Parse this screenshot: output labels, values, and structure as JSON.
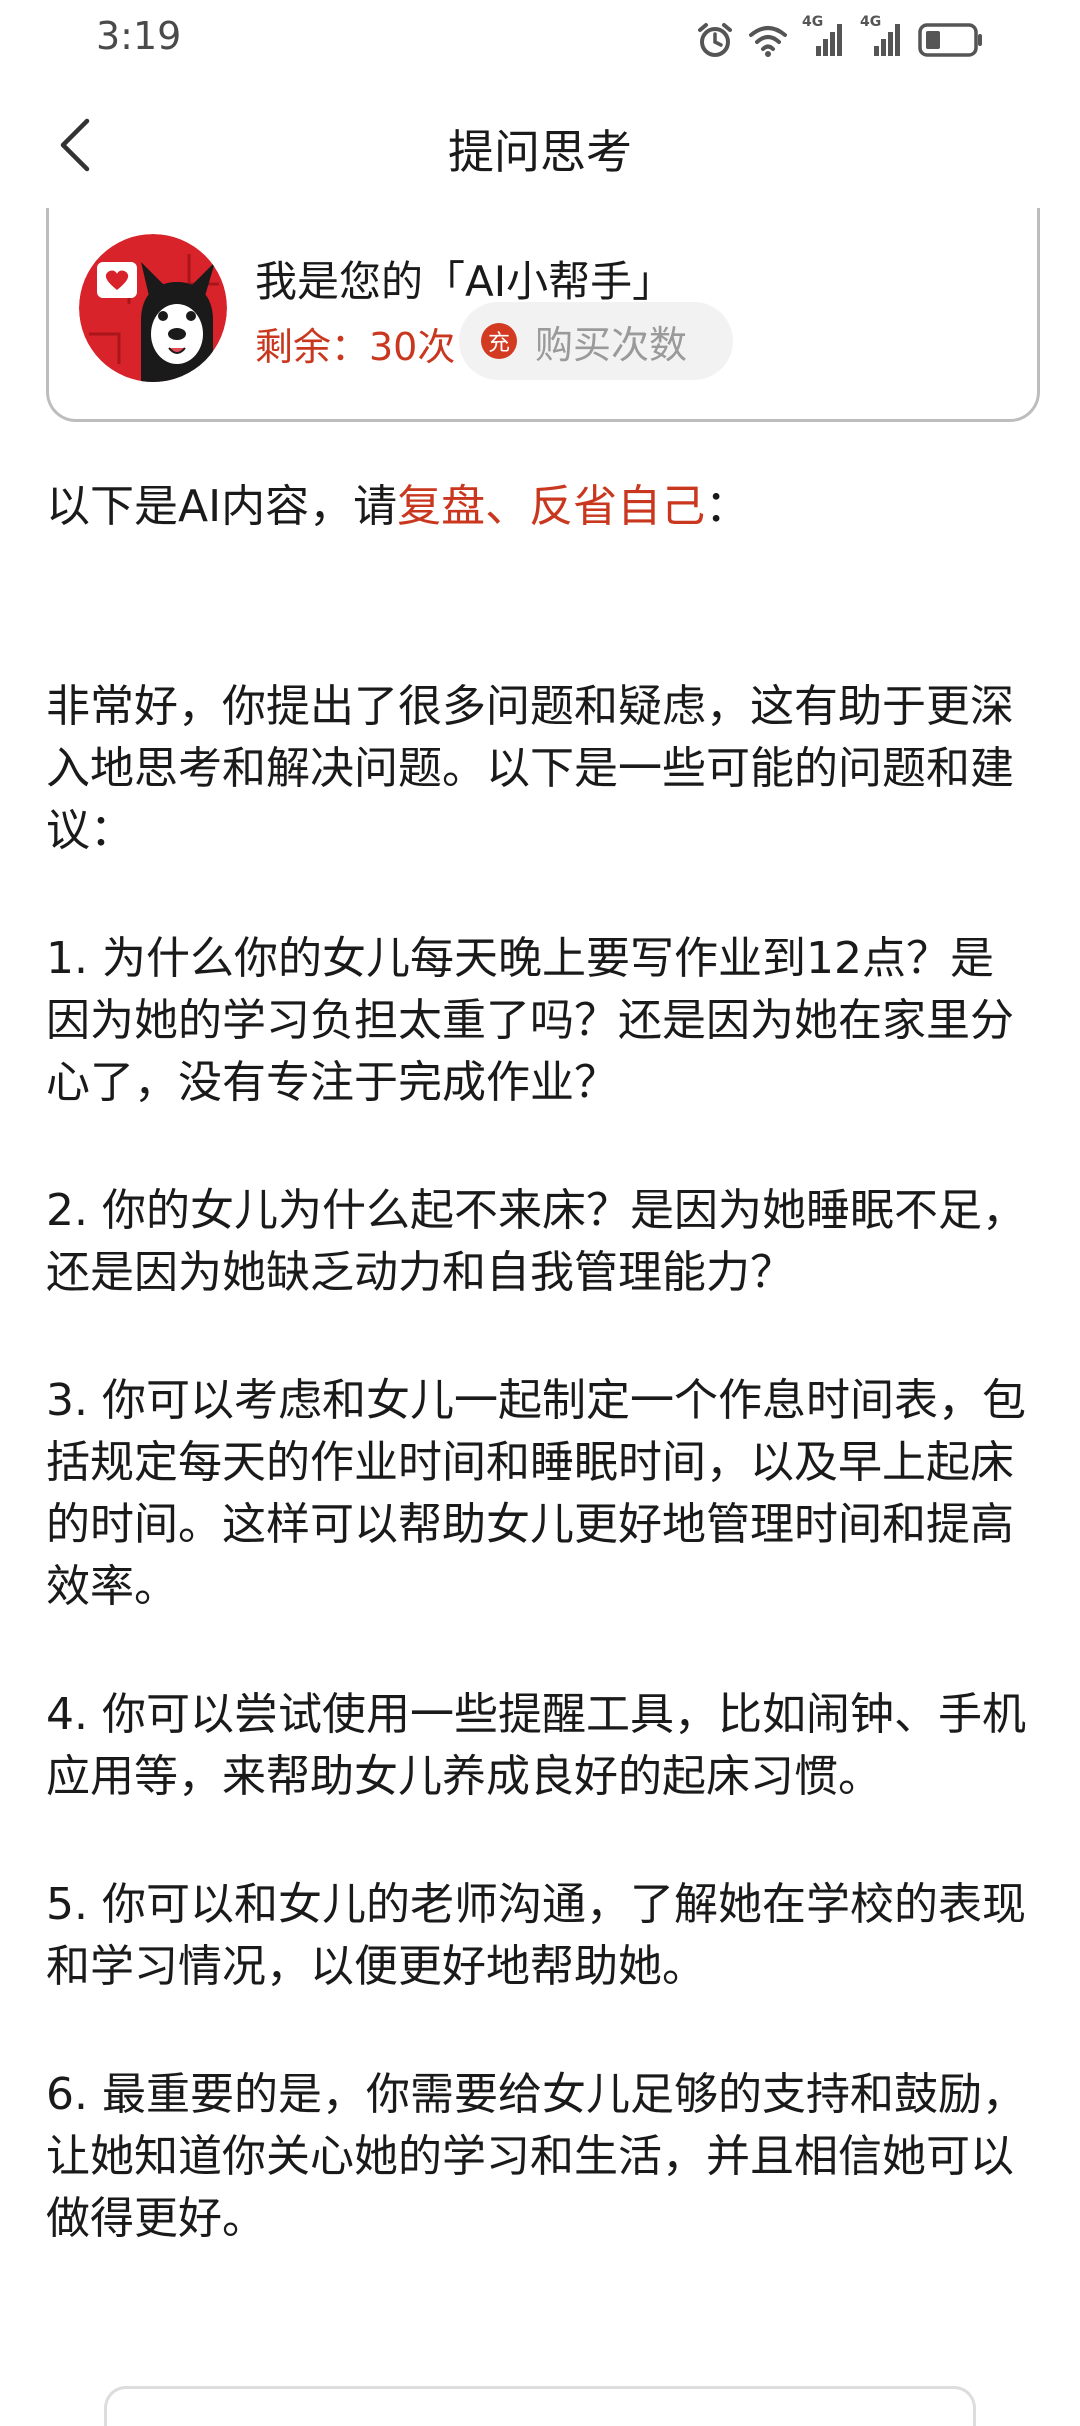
{
  "status_bar": {
    "time": "3:19",
    "network_1": "4G",
    "network_2": "4G",
    "icons": [
      "alarm-icon",
      "wifi-icon",
      "signal-icon",
      "signal-icon",
      "battery-icon"
    ]
  },
  "nav": {
    "title": "提问思考"
  },
  "helper_card": {
    "title": "我是您的「AI小帮手」",
    "remaining": "剩余：30次",
    "charge_badge": "充",
    "buy_label": "购买次数"
  },
  "intro": {
    "prefix": "以下是AI内容，请",
    "highlight": "复盘、反省自己",
    "suffix": "："
  },
  "answer": {
    "paragraphs": [
      "非常好，你提出了很多问题和疑虑，这有助于更深入地思考和解决问题。以下是一些可能的问题和建议：",
      "1. 为什么你的女儿每天晚上要写作业到12点？是因为她的学习负担太重了吗？还是因为她在家里分心了，没有专注于完成作业？",
      "2. 你的女儿为什么起不来床？是因为她睡眠不足，还是因为她缺乏动力和自我管理能力？",
      "3. 你可以考虑和女儿一起制定一个作息时间表，包括规定每天的作业时间和睡眠时间，以及早上起床的时间。这样可以帮助女儿更好地管理时间和提高效率。",
      "4. 你可以尝试使用一些提醒工具，比如闹钟、手机应用等，来帮助女儿养成良好的起床习惯。",
      "5. 你可以和女儿的老师沟通，了解她在学校的表现和学习情况，以便更好地帮助她。",
      "6. 最重要的是，你需要给女儿足够的支持和鼓励，让她知道你关心她的学习和生活，并且相信她可以做得更好。"
    ]
  },
  "colors": {
    "accent_red": "#c9371f",
    "text": "#1a1a1a",
    "muted": "#9a9a9a"
  }
}
